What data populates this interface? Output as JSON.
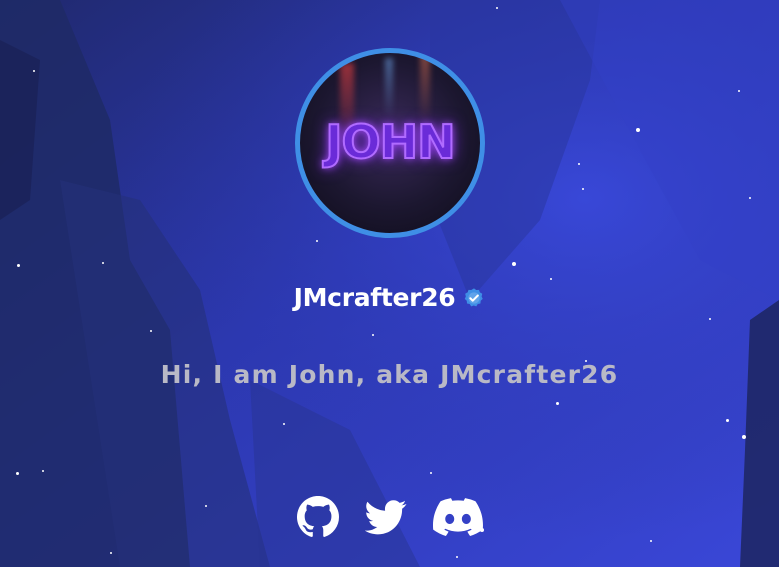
{
  "profile": {
    "username": "JMcrafter26",
    "verified": true,
    "avatar_text": "JOHN",
    "tagline": "Hi, I am John, aka JMcrafter26"
  },
  "socials": [
    {
      "icon": "github-icon",
      "name": "GitHub"
    },
    {
      "icon": "twitter-icon",
      "name": "Twitter"
    },
    {
      "icon": "discord-icon",
      "name": "Discord"
    }
  ],
  "colors": {
    "background_deep": "#1e2460",
    "background_accent": "#3342d6",
    "avatar_border": "#3f8fe6",
    "verified_badge": "#3f8fe6",
    "tagline": "#b9b9c6",
    "username": "#ffffff"
  }
}
